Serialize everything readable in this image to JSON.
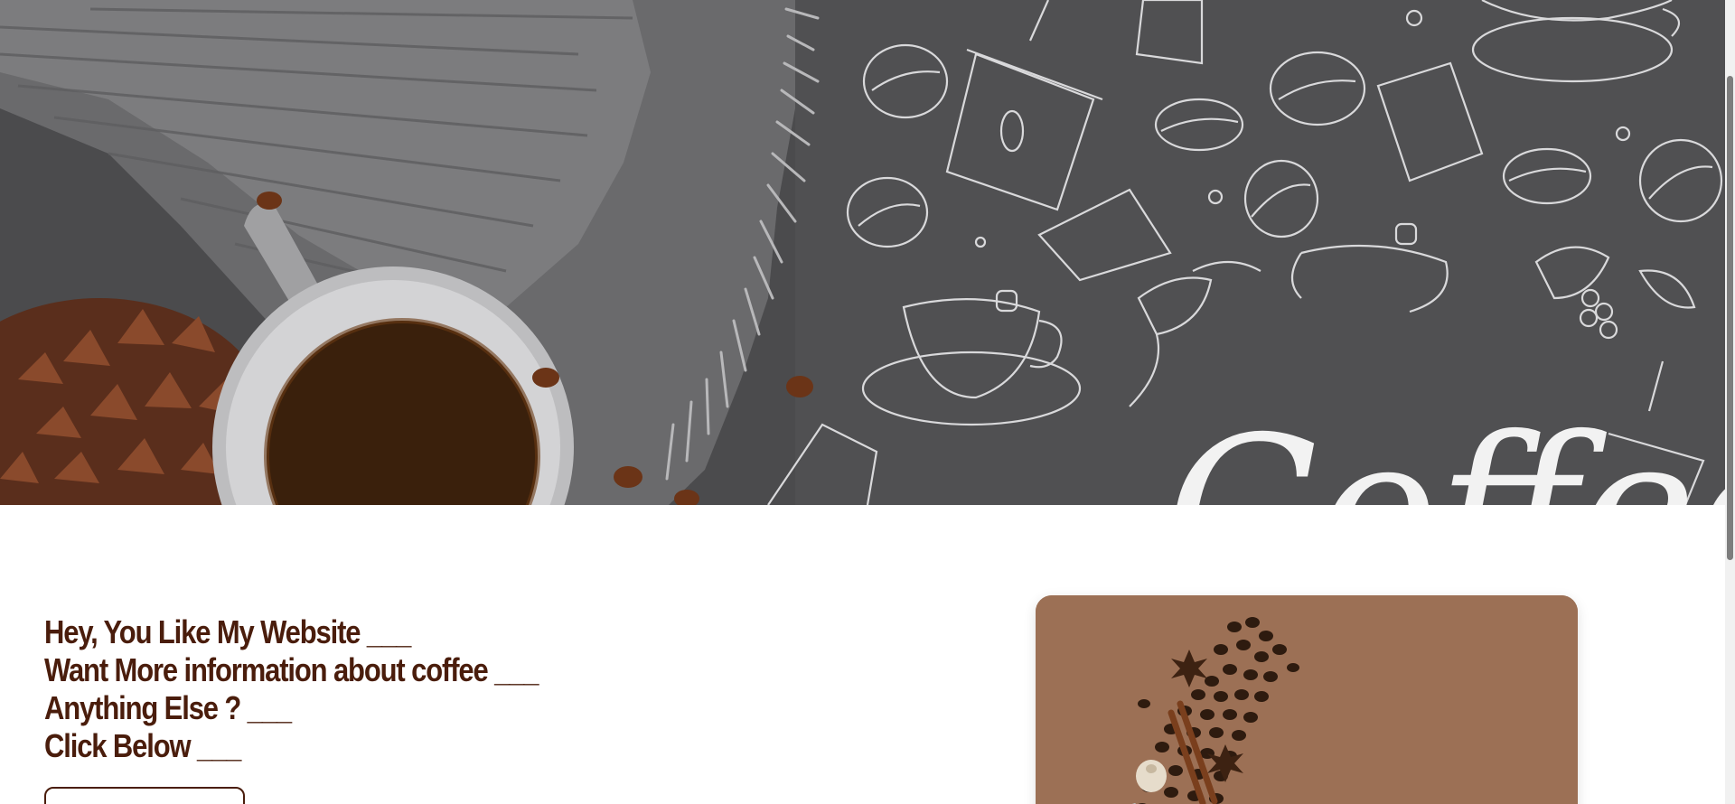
{
  "hero": {
    "partial_heading": "Coffee",
    "icons": [
      "coffee-cup-doodle-icon",
      "coffee-bean-icon",
      "takeaway-cup-icon",
      "coffee-bag-icon",
      "coffee-plant-icon"
    ]
  },
  "cta": {
    "lines": [
      "Hey, You Like My Website ___",
      "Want More information about coffee ___",
      "Anything Else ? ___",
      "Click Below ___"
    ],
    "button_label": ""
  },
  "colors": {
    "brand_brown": "#4a1d0c",
    "hero_background": "#4a4a4c",
    "card_background": "#9a6e52"
  }
}
